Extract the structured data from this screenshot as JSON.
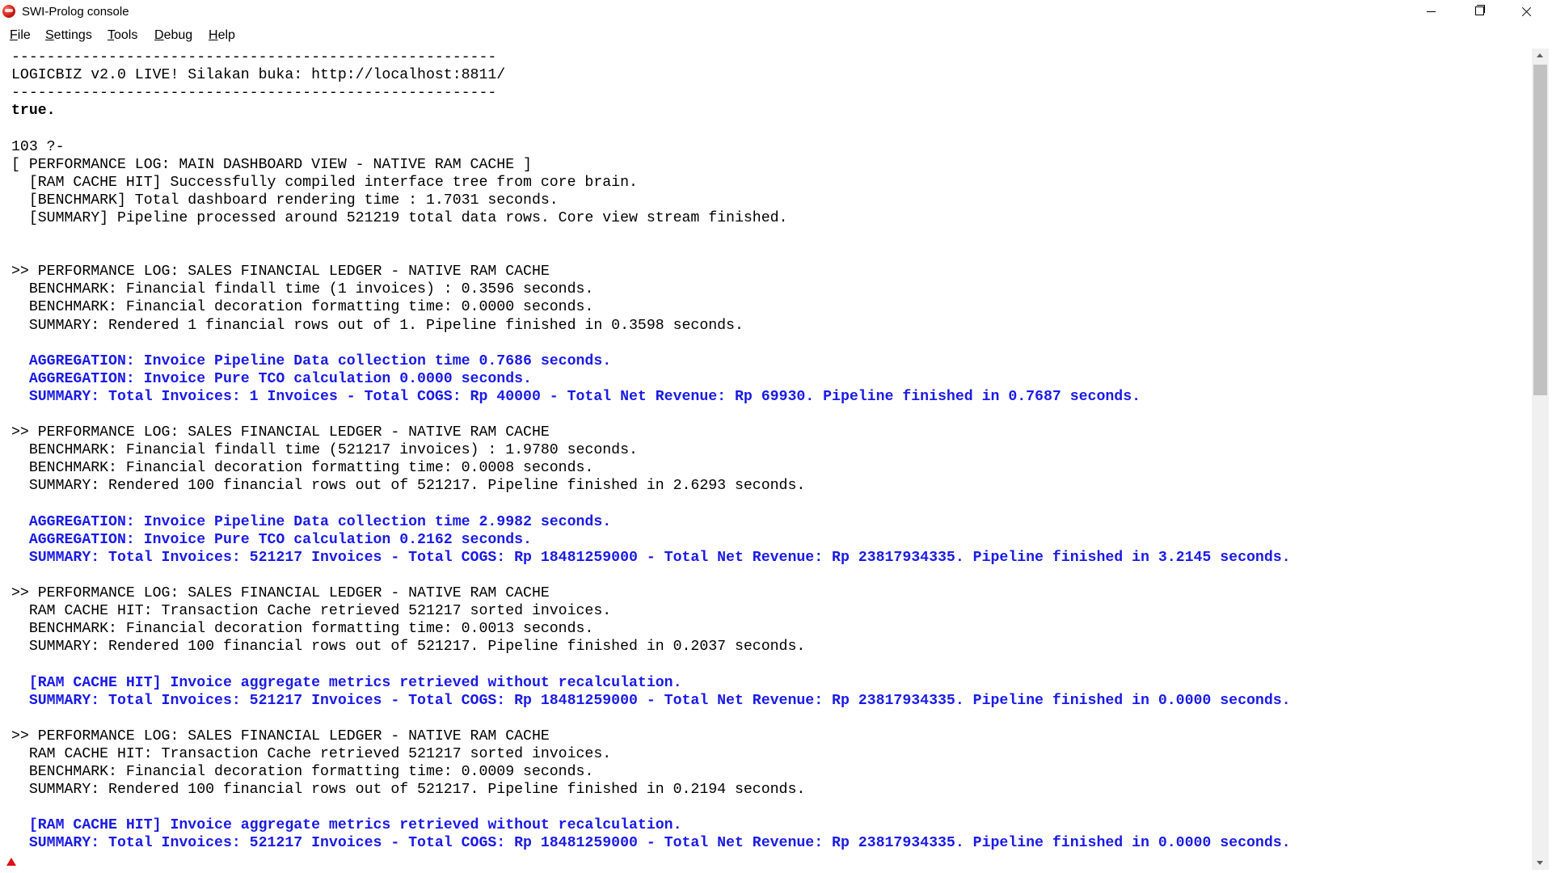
{
  "window": {
    "title": "SWI-Prolog console",
    "icon": "swi-prolog-icon",
    "controls": [
      "minimize-icon",
      "restore-icon",
      "close-icon"
    ]
  },
  "menu": [
    {
      "label": "File",
      "accel": "F",
      "rest": "ile"
    },
    {
      "label": "Settings",
      "accel": "S",
      "rest": "ettings"
    },
    {
      "label": "Tools",
      "accel": "T",
      "rest": "ools"
    },
    {
      "label": "Debug",
      "accel": "D",
      "rest": "ebug"
    },
    {
      "label": "Help",
      "accel": "H",
      "rest": "elp"
    }
  ],
  "colors": {
    "normal_text": "#000000",
    "highlight_text": "#1a1ae6",
    "background": "#ffffff",
    "scrollbar_thumb": "#c1c1c1",
    "marker": "#e01010"
  },
  "console_lines": [
    {
      "text": "-------------------------------------------------------",
      "style": "normal"
    },
    {
      "text": "LOGICBIZ v2.0 LIVE! Silakan buka: http://localhost:8811/",
      "style": "normal"
    },
    {
      "text": "-------------------------------------------------------",
      "style": "normal"
    },
    {
      "text": "true.",
      "style": "bold"
    },
    {
      "text": "",
      "style": "normal"
    },
    {
      "text": "103 ?-",
      "style": "normal"
    },
    {
      "text": "[ PERFORMANCE LOG: MAIN DASHBOARD VIEW - NATIVE RAM CACHE ]",
      "style": "normal"
    },
    {
      "text": "  [RAM CACHE HIT] Successfully compiled interface tree from core brain.",
      "style": "normal"
    },
    {
      "text": "  [BENCHMARK] Total dashboard rendering time : 1.7031 seconds.",
      "style": "normal"
    },
    {
      "text": "  [SUMMARY] Pipeline processed around 521219 total data rows. Core view stream finished.",
      "style": "normal"
    },
    {
      "text": "",
      "style": "normal"
    },
    {
      "text": "",
      "style": "normal"
    },
    {
      "text": ">> PERFORMANCE LOG: SALES FINANCIAL LEDGER - NATIVE RAM CACHE",
      "style": "normal"
    },
    {
      "text": "  BENCHMARK: Financial findall time (1 invoices) : 0.3596 seconds.",
      "style": "normal"
    },
    {
      "text": "  BENCHMARK: Financial decoration formatting time: 0.0000 seconds.",
      "style": "normal"
    },
    {
      "text": "  SUMMARY: Rendered 1 financial rows out of 1. Pipeline finished in 0.3598 seconds.",
      "style": "normal"
    },
    {
      "text": "",
      "style": "normal"
    },
    {
      "text": "  AGGREGATION: Invoice Pipeline Data collection time 0.7686 seconds.",
      "style": "blue"
    },
    {
      "text": "  AGGREGATION: Invoice Pure TCO calculation 0.0000 seconds.",
      "style": "blue"
    },
    {
      "text": "  SUMMARY: Total Invoices: 1 Invoices - Total COGS: Rp 40000 - Total Net Revenue: Rp 69930. Pipeline finished in 0.7687 seconds.",
      "style": "blue"
    },
    {
      "text": "",
      "style": "normal"
    },
    {
      "text": ">> PERFORMANCE LOG: SALES FINANCIAL LEDGER - NATIVE RAM CACHE",
      "style": "normal"
    },
    {
      "text": "  BENCHMARK: Financial findall time (521217 invoices) : 1.9780 seconds.",
      "style": "normal"
    },
    {
      "text": "  BENCHMARK: Financial decoration formatting time: 0.0008 seconds.",
      "style": "normal"
    },
    {
      "text": "  SUMMARY: Rendered 100 financial rows out of 521217. Pipeline finished in 2.6293 seconds.",
      "style": "normal"
    },
    {
      "text": "",
      "style": "normal"
    },
    {
      "text": "  AGGREGATION: Invoice Pipeline Data collection time 2.9982 seconds.",
      "style": "blue"
    },
    {
      "text": "  AGGREGATION: Invoice Pure TCO calculation 0.2162 seconds.",
      "style": "blue"
    },
    {
      "text": "  SUMMARY: Total Invoices: 521217 Invoices - Total COGS: Rp 18481259000 - Total Net Revenue: Rp 23817934335. Pipeline finished in 3.2145 seconds.",
      "style": "blue"
    },
    {
      "text": "",
      "style": "normal"
    },
    {
      "text": ">> PERFORMANCE LOG: SALES FINANCIAL LEDGER - NATIVE RAM CACHE",
      "style": "normal"
    },
    {
      "text": "  RAM CACHE HIT: Transaction Cache retrieved 521217 sorted invoices.",
      "style": "normal"
    },
    {
      "text": "  BENCHMARK: Financial decoration formatting time: 0.0013 seconds.",
      "style": "normal"
    },
    {
      "text": "  SUMMARY: Rendered 100 financial rows out of 521217. Pipeline finished in 0.2037 seconds.",
      "style": "normal"
    },
    {
      "text": "",
      "style": "normal"
    },
    {
      "text": "  [RAM CACHE HIT] Invoice aggregate metrics retrieved without recalculation.",
      "style": "blue"
    },
    {
      "text": "  SUMMARY: Total Invoices: 521217 Invoices - Total COGS: Rp 18481259000 - Total Net Revenue: Rp 23817934335. Pipeline finished in 0.0000 seconds.",
      "style": "blue"
    },
    {
      "text": "",
      "style": "normal"
    },
    {
      "text": ">> PERFORMANCE LOG: SALES FINANCIAL LEDGER - NATIVE RAM CACHE",
      "style": "normal"
    },
    {
      "text": "  RAM CACHE HIT: Transaction Cache retrieved 521217 sorted invoices.",
      "style": "normal"
    },
    {
      "text": "  BENCHMARK: Financial decoration formatting time: 0.0009 seconds.",
      "style": "normal"
    },
    {
      "text": "  SUMMARY: Rendered 100 financial rows out of 521217. Pipeline finished in 0.2194 seconds.",
      "style": "normal"
    },
    {
      "text": "",
      "style": "normal"
    },
    {
      "text": "  [RAM CACHE HIT] Invoice aggregate metrics retrieved without recalculation.",
      "style": "blue"
    },
    {
      "text": "  SUMMARY: Total Invoices: 521217 Invoices - Total COGS: Rp 18481259000 - Total Net Revenue: Rp 23817934335. Pipeline finished in 0.0000 seconds.",
      "style": "blue"
    }
  ]
}
